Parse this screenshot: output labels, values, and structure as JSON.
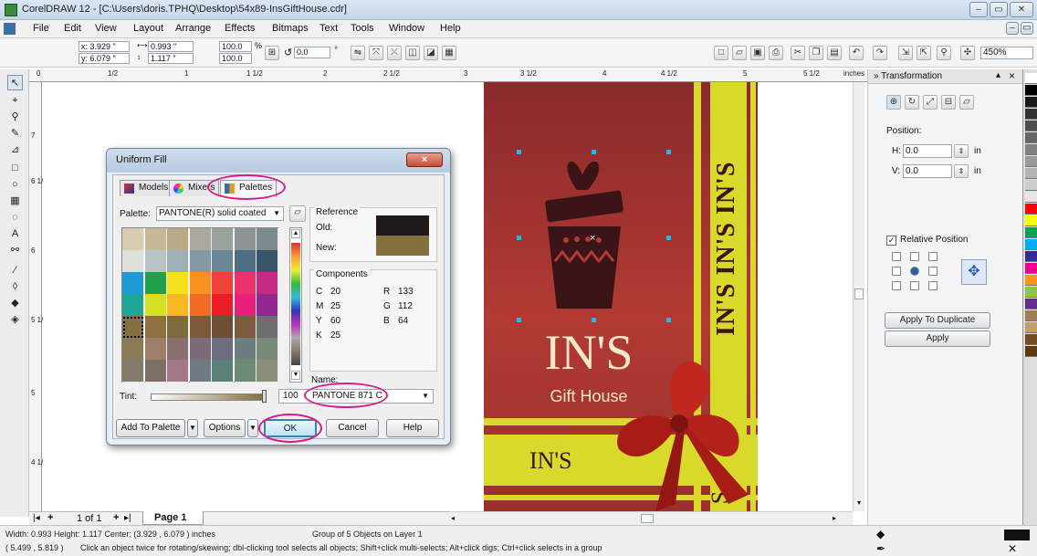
{
  "window": {
    "title": "CorelDRAW 12 - [C:\\Users\\doris.TPHQ\\Desktop\\54x89-InsGiftHouse.cdr]",
    "controls": [
      "–",
      "▭",
      "✕"
    ]
  },
  "menu": [
    "File",
    "Edit",
    "View",
    "Layout",
    "Arrange",
    "Effects",
    "Bitmaps",
    "Text",
    "Tools",
    "Window",
    "Help"
  ],
  "propbar": {
    "x": "x: 3.929 \"",
    "y": "y: 6.079 \"",
    "width": "0.993 \"",
    "height": "1.117 \"",
    "scale_x": "100.0",
    "scale_y": "100.0",
    "percent": "%",
    "rotation": "0.0",
    "degree": "°",
    "zoom": "450%"
  },
  "ruler": {
    "h_labels": [
      "0",
      "1/2",
      "1",
      "1 1/2",
      "2",
      "2 1/2",
      "3",
      "3 1/2",
      "4",
      "4 1/2",
      "5",
      "5 1/2"
    ],
    "units": "inches",
    "v_labels": [
      "7",
      "6 1/2",
      "6",
      "5 1/2",
      "5",
      "4 1/2"
    ]
  },
  "artwork": {
    "brand": "IN'S",
    "tagline": "Gift House",
    "vertical_text": "IN'S IN'S IN'S",
    "small_brand": "IN'S",
    "bottom_letter": "S",
    "colors": {
      "background": "#a8352f",
      "stripe": "#d8d92a",
      "cream": "#f6e9c8",
      "dark": "#3a1416",
      "bow": "#c2271f"
    }
  },
  "pages": {
    "counter": "1 of 1",
    "current_tab": "Page 1"
  },
  "status": {
    "line1_left": "Width: 0.993  Height: 1.117  Center: (3.929 , 6.079 )  inches",
    "line1_right": "Group of 5 Objects on Layer 1",
    "line2_coords": "( 5.499 , 5.819 )",
    "line2_hint": "Click an object twice for rotating/skewing; dbl-clicking tool selects all objects; Shift+click multi-selects; Alt+click digs; Ctrl+click selects in a group"
  },
  "docker": {
    "title": "Transformation",
    "position_label": "Position:",
    "h_label": "H:",
    "h_value": "0.0",
    "v_label": "V:",
    "v_value": "0.0",
    "unit": "in",
    "relative_position": "Relative Position",
    "apply_to_duplicate": "Apply To Duplicate",
    "apply": "Apply"
  },
  "dialog": {
    "title": "Uniform Fill",
    "tabs": [
      "Models",
      "Mixers",
      "Palettes"
    ],
    "palette_label": "Palette:",
    "palette_value": "PANTONE(R) solid coated",
    "reference_label": "Reference",
    "old_label": "Old:",
    "new_label": "New:",
    "components_label": "Components",
    "components": {
      "c_label": "C",
      "c": "20",
      "m_label": "M",
      "m": "25",
      "y_label": "Y",
      "y": "60",
      "k_label": "K",
      "k": "25",
      "r_label": "R",
      "r": "133",
      "g_label": "G",
      "g": "112",
      "b_label": "B",
      "b": "64"
    },
    "name_label": "Name:",
    "name_value": "PANTONE 871 C",
    "tint_label": "Tint:",
    "tint_value": "100",
    "buttons": {
      "add_to_palette": "Add To Palette",
      "options": "Options",
      "ok": "OK",
      "cancel": "Cancel",
      "help": "Help"
    },
    "old_color": "#1f1a17",
    "new_color": "#857040",
    "swatches": [
      [
        "#d8cdb1",
        "#c6b997",
        "#b8a987",
        "#a9a9a0",
        "#9aa39a",
        "#8c9595",
        "#7d8a8d"
      ],
      [
        "#dfe0dc",
        "#b8c3c5",
        "#9fb0b7",
        "#8399a6",
        "#6a8798",
        "#4e6e84",
        "#38556a"
      ],
      [
        "#1c9ad6",
        "#20a04a",
        "#f4e31c",
        "#f7931e",
        "#ef4136",
        "#e8346a",
        "#c42a84"
      ],
      [
        "#1da695",
        "#d7df23",
        "#f9b81f",
        "#f26c23",
        "#ec1c24",
        "#e9207a",
        "#92278f"
      ],
      [
        "#857040",
        "#8f6f3f",
        "#7e6a3c",
        "#7a5a3a",
        "#6f4e37",
        "#7d5b3d",
        "#6e6e6e"
      ],
      [
        "#8b7a56",
        "#9c7f6a",
        "#8a6f6f",
        "#7b6b79",
        "#6c6e80",
        "#6b7d7f",
        "#7a8a78"
      ],
      [
        "#837a6b",
        "#7c6f66",
        "#a27985",
        "#6f7a82",
        "#5b8079",
        "#6c8b73",
        "#8a8f7c"
      ]
    ]
  },
  "color_palette": [
    "#ffffff",
    "#000000",
    "#1a1a1a",
    "#333333",
    "#4d4d4d",
    "#666666",
    "#808080",
    "#999999",
    "#b3b3b3",
    "#cccccc",
    "#e6e6e6",
    "#ff0000",
    "#ffff00",
    "#00a651",
    "#00aeef",
    "#2e3192",
    "#ec008c",
    "#f7941d",
    "#8dc63f",
    "#662d91",
    "#a67c52",
    "#c69c6d",
    "#754c24",
    "#603913"
  ]
}
